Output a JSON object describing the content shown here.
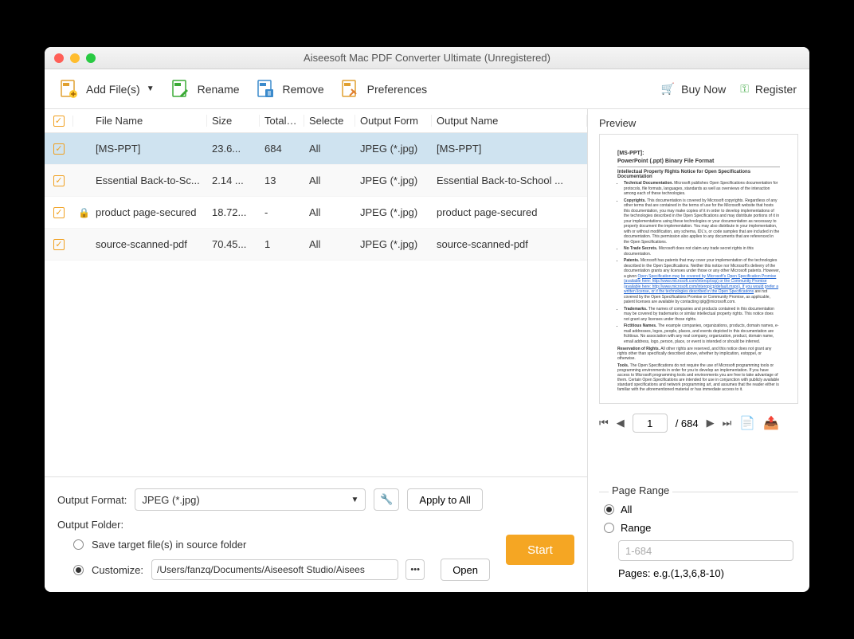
{
  "window": {
    "title": "Aiseesoft Mac PDF Converter Ultimate (Unregistered)"
  },
  "toolbar": {
    "add_files": "Add File(s)",
    "rename": "Rename",
    "remove": "Remove",
    "preferences": "Preferences",
    "buy_now": "Buy Now",
    "register": "Register"
  },
  "table": {
    "headers": {
      "filename": "File Name",
      "size": "Size",
      "total": "Total Pa",
      "selected": "Selecte",
      "format": "Output Form",
      "output_name": "Output Name"
    },
    "rows": [
      {
        "checked": true,
        "locked": false,
        "filename": "[MS-PPT]",
        "size": "23.6...",
        "total": "684",
        "selected": "All",
        "format": "JPEG (*.jpg)",
        "output": "[MS-PPT]",
        "sel": true
      },
      {
        "checked": true,
        "locked": false,
        "filename": "Essential Back-to-Sc...",
        "size": "2.14 ...",
        "total": "13",
        "selected": "All",
        "format": "JPEG (*.jpg)",
        "output": "Essential Back-to-School ...",
        "sel": false
      },
      {
        "checked": true,
        "locked": true,
        "filename": "product page-secured",
        "size": "18.72...",
        "total": "-",
        "selected": "All",
        "format": "JPEG (*.jpg)",
        "output": "product page-secured",
        "sel": false
      },
      {
        "checked": true,
        "locked": false,
        "filename": "source-scanned-pdf",
        "size": "70.45...",
        "total": "1",
        "selected": "All",
        "format": "JPEG (*.jpg)",
        "output": "source-scanned-pdf",
        "sel": false
      }
    ]
  },
  "bottom": {
    "output_format_label": "Output Format:",
    "output_format_value": "JPEG (*.jpg)",
    "apply_all": "Apply to All",
    "output_folder_label": "Output Folder:",
    "save_source": "Save target file(s) in source folder",
    "customize": "Customize:",
    "path": "/Users/fanzq/Documents/Aiseesoft Studio/Aisees",
    "open": "Open",
    "start": "Start"
  },
  "preview": {
    "label": "Preview",
    "doc_title1": "[MS-PPT]:",
    "doc_title2": "PowerPoint (.ppt) Binary File Format",
    "ip_header": "Intellectual Property Rights Notice for Open Specifications Documentation",
    "current_page": "1",
    "total_pages": "/ 684"
  },
  "page_range": {
    "legend": "Page Range",
    "all": "All",
    "range": "Range",
    "placeholder": "1-684",
    "hint": "Pages: e.g.(1,3,6,8-10)"
  }
}
